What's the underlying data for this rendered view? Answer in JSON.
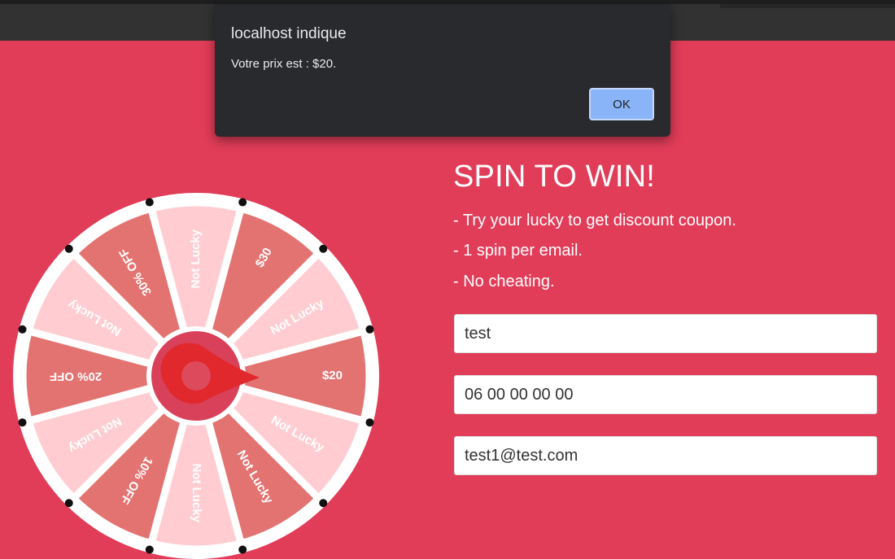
{
  "dialog": {
    "title": "localhost indique",
    "message": "Votre prix est : $20.",
    "ok_label": "OK"
  },
  "promo": {
    "title": "SPIN TO WIN!",
    "rules": [
      "- Try your lucky to get discount coupon.",
      "- 1 spin per email.",
      "- No cheating."
    ]
  },
  "form": {
    "name_value": "test",
    "phone_value": "06 00 00 00 00",
    "email_value": "test1@test.com"
  },
  "wheel": {
    "segments": [
      {
        "label": "$20",
        "color": "#e37371"
      },
      {
        "label": "Not Lucky",
        "color": "#ffcdd1"
      },
      {
        "label": "Not Lucky",
        "color": "#e37371"
      },
      {
        "label": "Not Lucky",
        "color": "#ffcdd1"
      },
      {
        "label": "10% OFF",
        "color": "#e37371"
      },
      {
        "label": "Not Lucky",
        "color": "#ffcdd1"
      },
      {
        "label": "20% OFF",
        "color": "#e37371"
      },
      {
        "label": "Not Lucky",
        "color": "#ffcdd1"
      },
      {
        "label": "30% OFF",
        "color": "#e37371"
      },
      {
        "label": "Not Lucky",
        "color": "#ffcdd1"
      },
      {
        "label": "$30",
        "color": "#e37371"
      },
      {
        "label": "Not Lucky",
        "color": "#ffcdd1"
      }
    ],
    "colors": {
      "rim": "#ffffff",
      "peg": "#111111",
      "hub_outer": "#d94059",
      "pointer": "#e0282d",
      "hub_center": "#dd4a5c"
    }
  },
  "colors": {
    "background": "#e13c58",
    "topbar": "#323232",
    "dialog_bg": "#292a2d",
    "dialog_button": "#8ab4f8"
  }
}
